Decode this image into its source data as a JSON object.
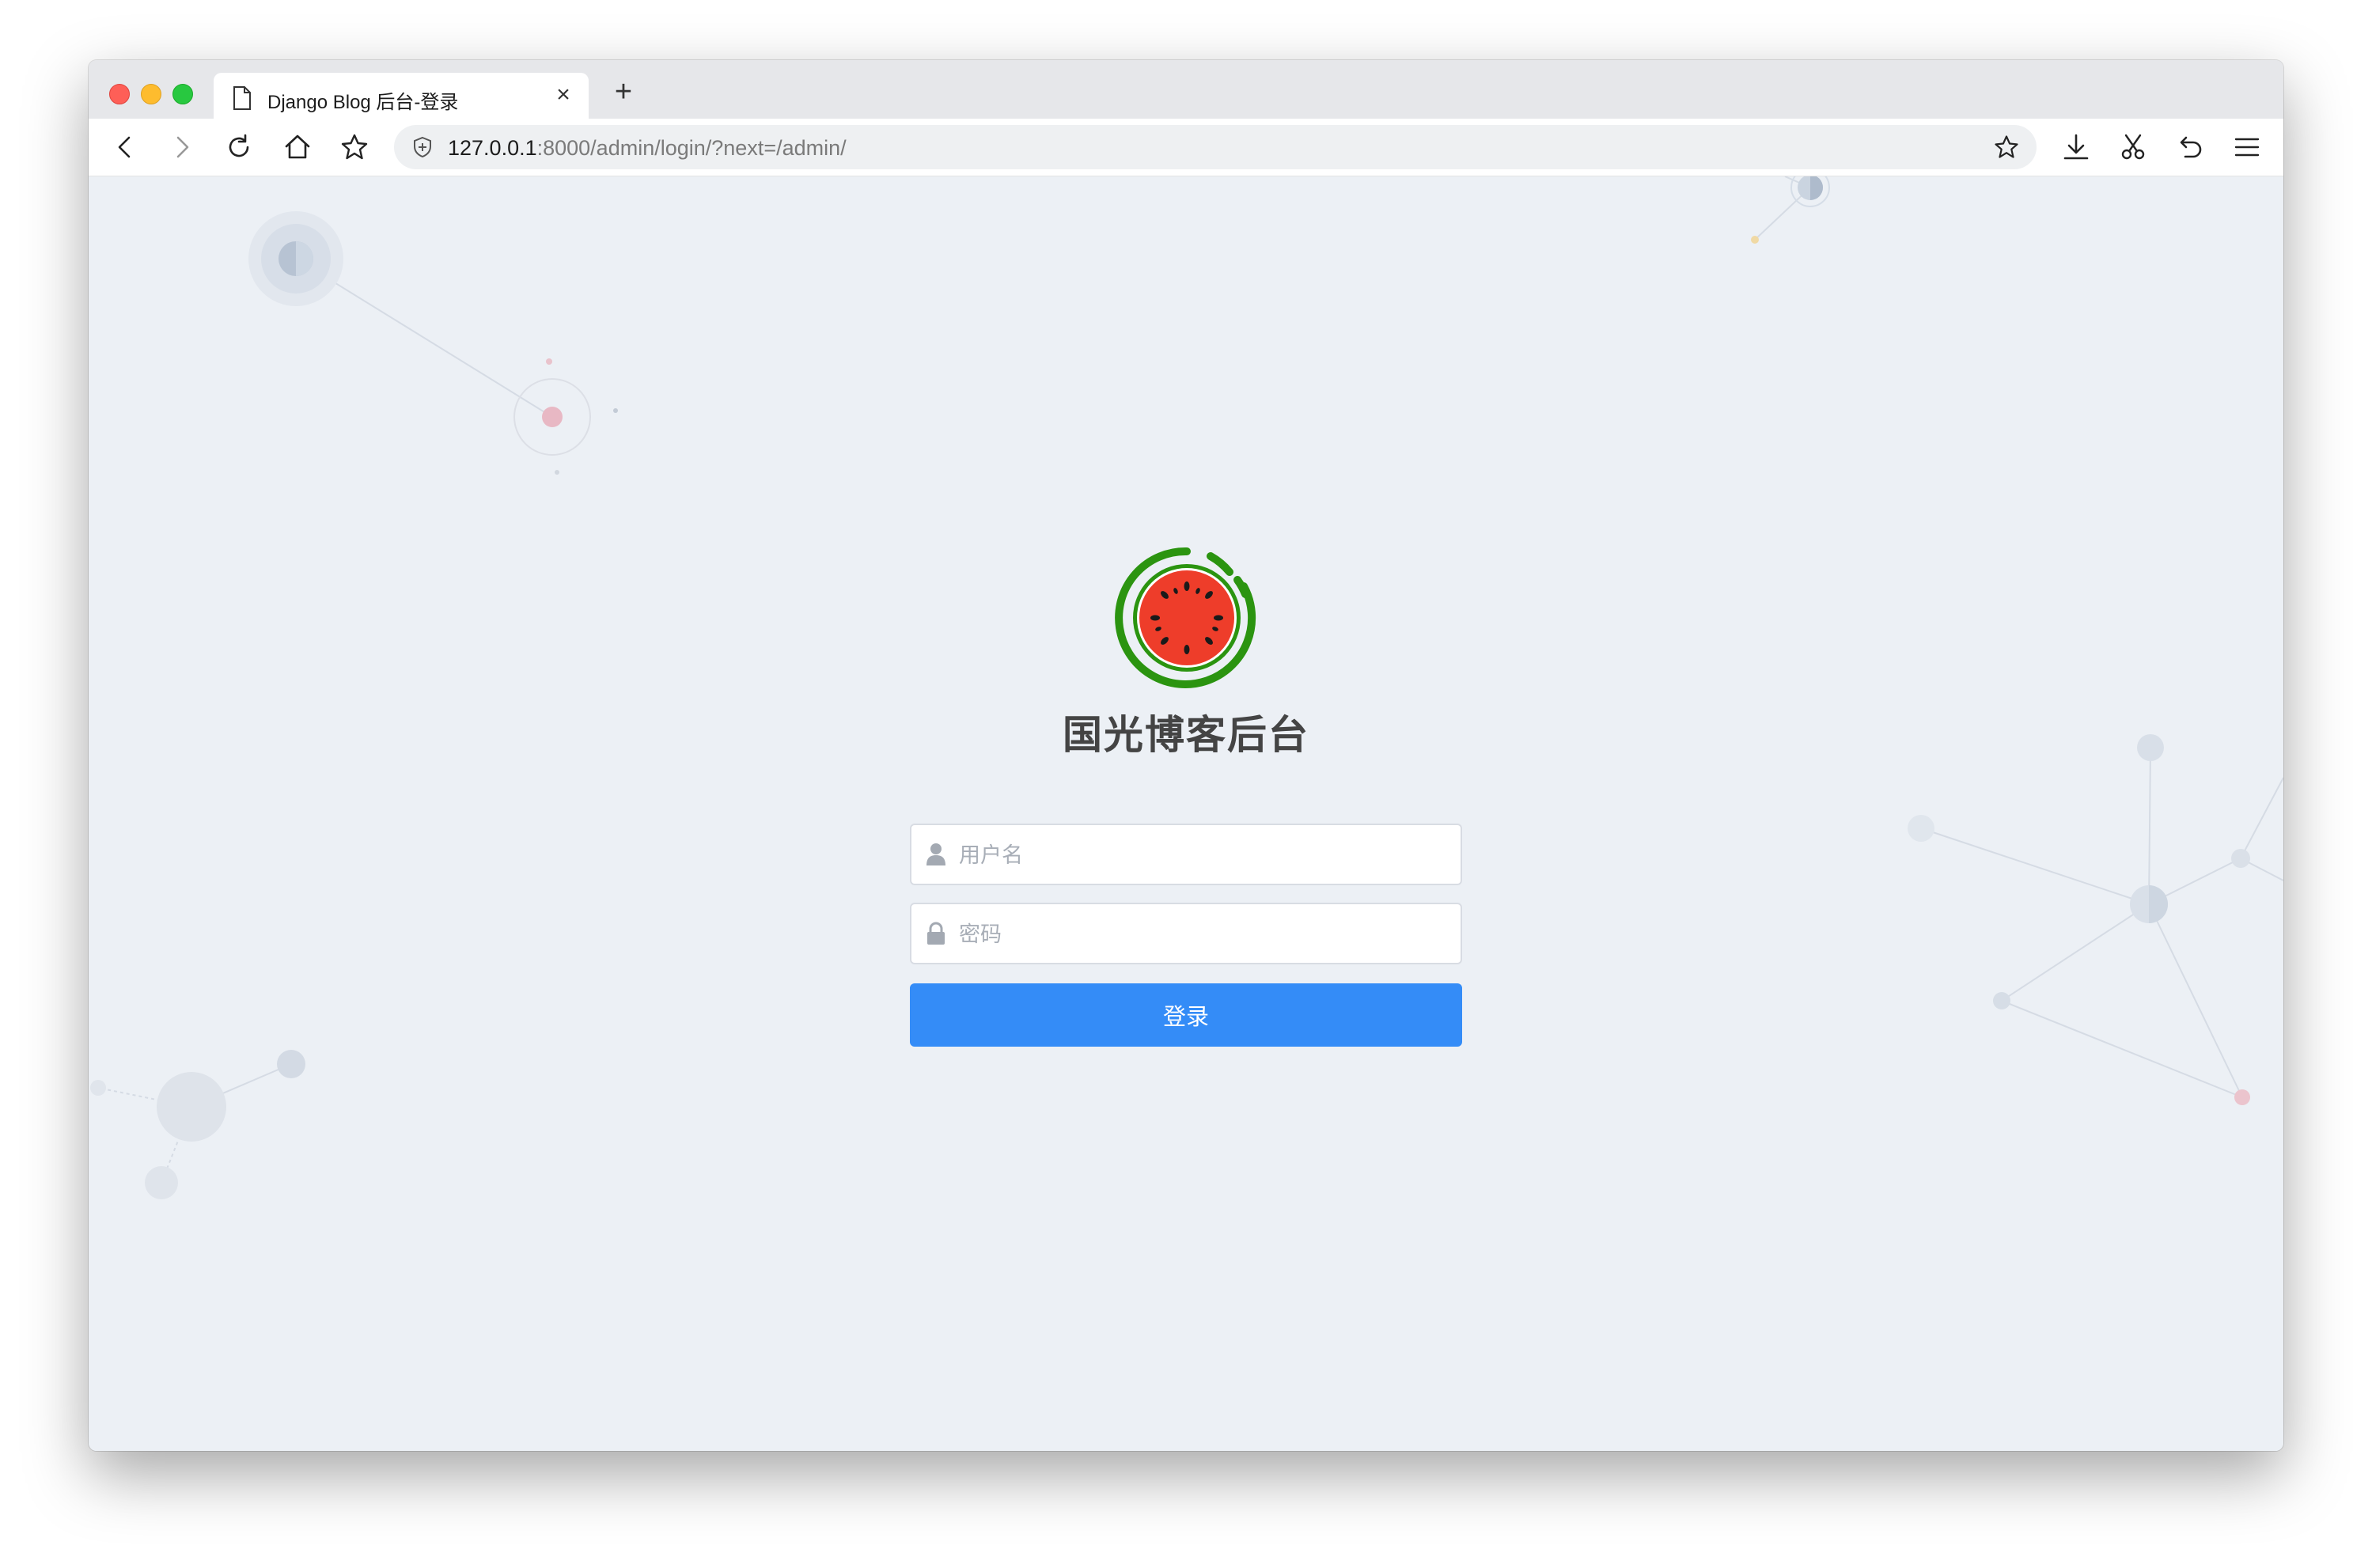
{
  "browser": {
    "tab_title": "Django Blog 后台-登录",
    "new_tab_label": "+",
    "close_tab_label": "×",
    "url_host": "127.0.0.1",
    "url_rest": ":8000/admin/login/?next=/admin/"
  },
  "login": {
    "site_title": "国光博客后台",
    "username_placeholder": "用户名",
    "username_value": "",
    "password_placeholder": "密码",
    "password_value": "",
    "submit_label": "登录"
  },
  "colors": {
    "accent": "#348cf7",
    "background": "#ecf0f5",
    "logo_rind": "#2b9410",
    "logo_flesh": "#ee3d2a"
  },
  "icons": {
    "back": "arrow-left-icon",
    "forward": "arrow-right-icon",
    "reload": "reload-icon",
    "home": "home-icon",
    "bookmark": "star-icon",
    "download": "download-icon",
    "cut": "scissors-icon",
    "undo": "undo-icon",
    "menu": "hamburger-icon"
  }
}
